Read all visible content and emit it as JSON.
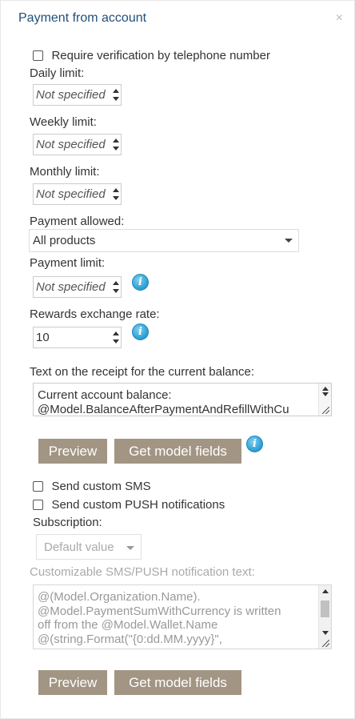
{
  "header": {
    "title": "Payment from account",
    "close_glyph": "×"
  },
  "verification": {
    "label": "Require verification by telephone number",
    "checked": false
  },
  "daily_limit": {
    "label": "Daily limit:",
    "value": "Not specified"
  },
  "weekly_limit": {
    "label": "Weekly limit:",
    "value": "Not specified"
  },
  "monthly_limit": {
    "label": "Monthly limit:",
    "value": "Not specified"
  },
  "payment_allowed": {
    "label": "Payment allowed:",
    "value": "All products"
  },
  "payment_limit": {
    "label": "Payment limit:",
    "value": "Not specified"
  },
  "rewards_rate": {
    "label": "Rewards exchange rate:",
    "value": "10"
  },
  "receipt_text": {
    "label": "Text on the receipt for the current balance:",
    "value": "Current account balance:\n@Model.BalanceAfterPaymentAndRefillWithCu"
  },
  "buttons_1": {
    "preview": "Preview",
    "model_fields": "Get model fields"
  },
  "send_sms": {
    "label": "Send custom SMS",
    "checked": false
  },
  "send_push": {
    "label": "Send custom PUSH notifications",
    "checked": false
  },
  "subscription": {
    "label": "Subscription:",
    "value": "Default value"
  },
  "notification_text": {
    "label": "Customizable SMS/PUSH notification text:",
    "value": "@(Model.Organization.Name).\n@Model.PaymentSumWithCurrency is written\noff from the @Model.Wallet.Name\n@(string.Format(\"{0:dd.MM.yyyy}\","
  },
  "buttons_2": {
    "preview": "Preview",
    "model_fields": "Get model fields"
  },
  "icons": {
    "info": "info-icon",
    "close": "close-icon",
    "spinner": "spinner-arrows-icon"
  },
  "colors": {
    "title": "#1f4f7a",
    "button_bg": "#a29583",
    "info_icon": "#2a9bd0"
  }
}
